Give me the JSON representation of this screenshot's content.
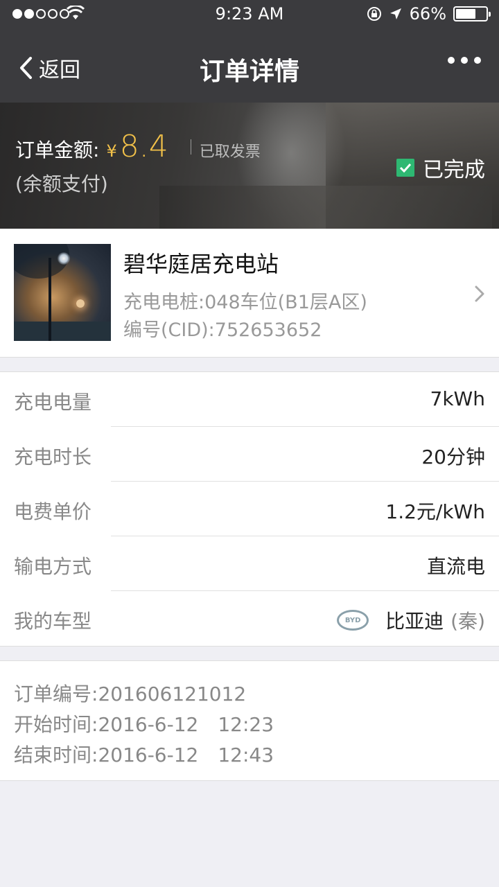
{
  "status_bar": {
    "time": "9:23 AM",
    "battery_percent": "66%",
    "battery_level": 0.66,
    "signal_bars_filled": 2,
    "signal_bars_total": 5
  },
  "nav": {
    "back_label": "返回",
    "title": "订单详情"
  },
  "hero": {
    "amount_label": "订单金额:",
    "currency": "¥",
    "amount": "8.4",
    "invoice_status": "已取发票",
    "payment_method": "(余额支付)",
    "order_status": "已完成",
    "status_color": "#2eb872",
    "amount_color": "#f2c149"
  },
  "station": {
    "name": "碧华庭居充电站",
    "pile": "充电电桩:048车位(B1层A区)",
    "cid": "编号(CID):752653652"
  },
  "details": [
    {
      "label": "充电电量",
      "value": "7kWh"
    },
    {
      "label": "充电时长",
      "value": "20分钟"
    },
    {
      "label": "电费单价",
      "value": "1.2元/kWh"
    },
    {
      "label": "输电方式",
      "value": "直流电"
    },
    {
      "label": "我的车型",
      "value": "比亚迪",
      "value_sub": "(秦)",
      "brand_logo": "BYD"
    }
  ],
  "order_info": {
    "order_no_label": "订单编号:",
    "order_no": "201606121012",
    "start_label": "开始时间:",
    "start_time": "2016-6-12　12:23",
    "end_label": "结束时间:",
    "end_time": "2016-6-12　12:43"
  }
}
